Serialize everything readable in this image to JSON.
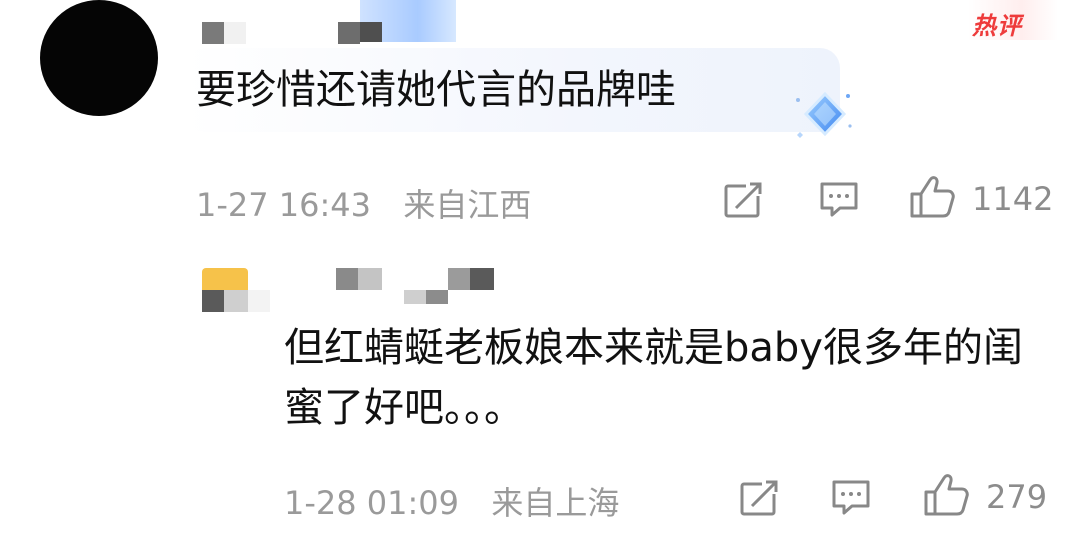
{
  "comments": [
    {
      "text": "要珍惜还请她代言的品牌哇",
      "badge": "热评",
      "time": "1-27 16:43",
      "location": "来自江西",
      "likes": "1142",
      "icons": [
        "share-icon",
        "comment-icon",
        "thumbs-up-icon"
      ]
    },
    {
      "text": "但红蜻蜓老板娘本来就是baby很多年的闺蜜了好吧。。。",
      "time": "1-28 01:09",
      "location": "来自上海",
      "likes": "279",
      "icons": [
        "share-icon",
        "comment-icon",
        "thumbs-up-icon"
      ]
    }
  ],
  "colors": {
    "badge": "#ee3b3b",
    "meta": "#9a9a9a",
    "text": "#111111"
  }
}
